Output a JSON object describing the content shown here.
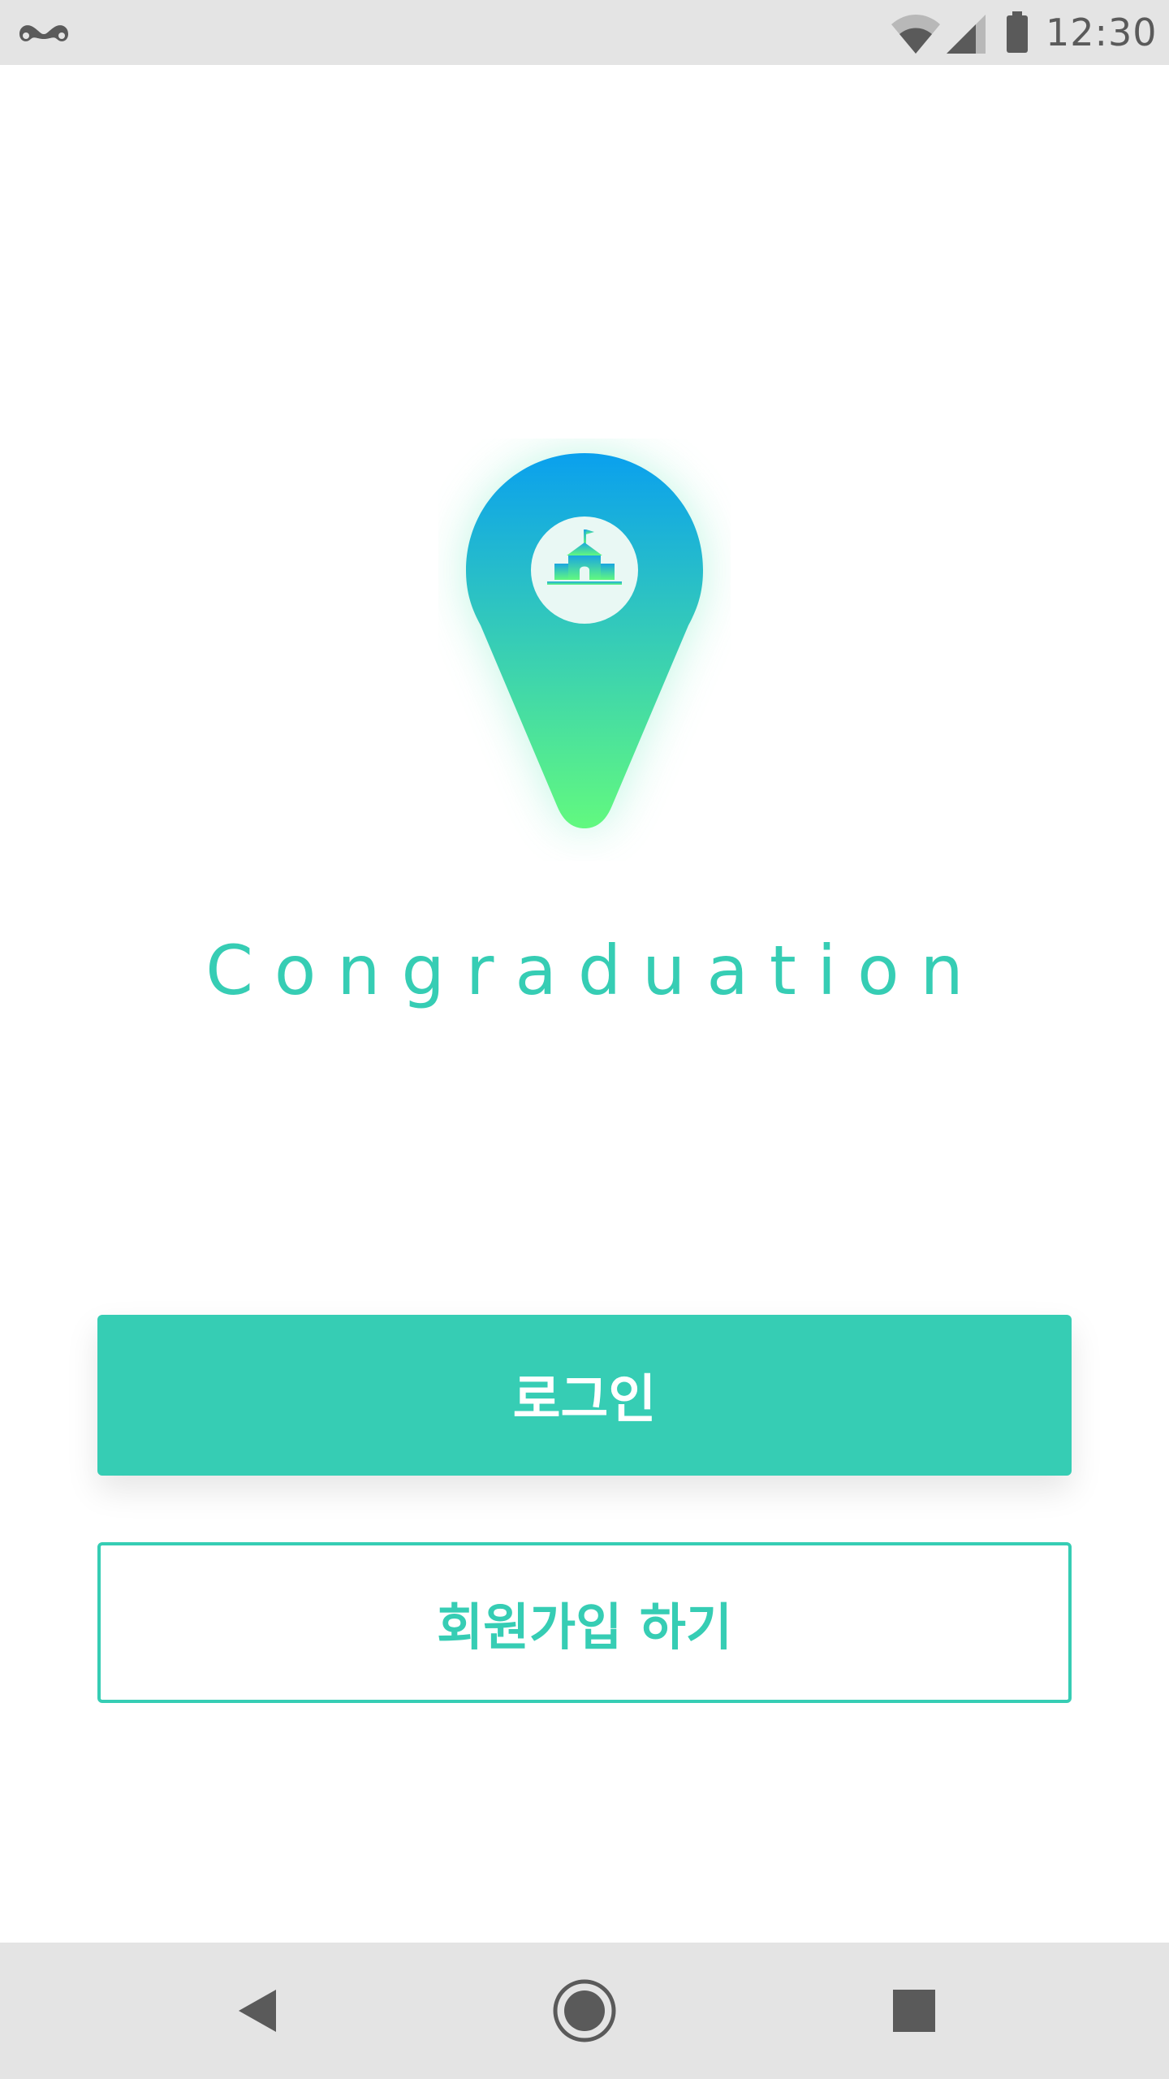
{
  "status_bar": {
    "time": "12:30",
    "icons": [
      "notification-mustache-icon",
      "wifi-icon",
      "cell-signal-icon",
      "battery-icon"
    ]
  },
  "brand": {
    "title": "Congraduation",
    "logo_icon": "school-map-pin-icon"
  },
  "actions": {
    "login_label": "로그인",
    "signup_label": "회원가입 하기"
  },
  "nav_bar": {
    "icons": [
      "back-icon",
      "home-icon",
      "recents-icon"
    ]
  },
  "colors": {
    "accent": "#36cdb4",
    "gradient_top": "#0aa0ee",
    "gradient_bottom": "#62f97f",
    "status_bar_bg": "#e4e4e4",
    "icon_gray": "#5a5a5a"
  }
}
